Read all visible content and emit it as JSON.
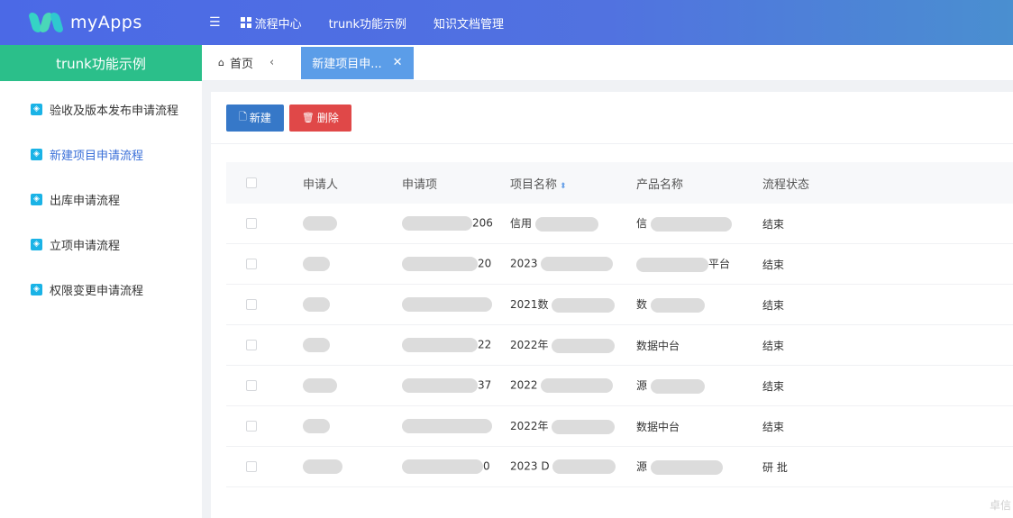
{
  "app": {
    "name": "myApps"
  },
  "topnav": [
    {
      "label": "流程中心"
    },
    {
      "label": "trunk功能示例"
    },
    {
      "label": "知识文档管理"
    }
  ],
  "sidebar": {
    "title": "trunk功能示例",
    "items": [
      {
        "label": "验收及版本发布申请流程"
      },
      {
        "label": "新建项目申请流程"
      },
      {
        "label": "出库申请流程"
      },
      {
        "label": "立项申请流程"
      },
      {
        "label": "权限变更申请流程"
      }
    ]
  },
  "tabs": {
    "home": "首页",
    "active": "新建项目申..."
  },
  "toolbar": {
    "new_label": "新建",
    "delete_label": "删除"
  },
  "table": {
    "columns": [
      "申请人",
      "申请项",
      "项目名称",
      "产品名称",
      "流程状态"
    ],
    "rows": [
      {
        "applicant": "",
        "number": "206",
        "project": "信用",
        "product": "信",
        "status": "结束"
      },
      {
        "applicant": "",
        "number": "20",
        "project": "2023",
        "product": "平台",
        "status": "结束"
      },
      {
        "applicant": "",
        "number": "",
        "project": "2021数",
        "product": "数",
        "status": "结束"
      },
      {
        "applicant": "",
        "number": "22",
        "project": "2022年",
        "product": "数据中台",
        "status": "结束"
      },
      {
        "applicant": "",
        "number": "37",
        "project": "2022",
        "product": "源",
        "status": "结束"
      },
      {
        "applicant": "",
        "number": "",
        "project": "2022年",
        "product": "数据中台",
        "status": "结束"
      },
      {
        "applicant": "",
        "number": "0",
        "project": "2023 D",
        "product": "源",
        "status": "研 批"
      }
    ]
  },
  "watermark": "卓信"
}
